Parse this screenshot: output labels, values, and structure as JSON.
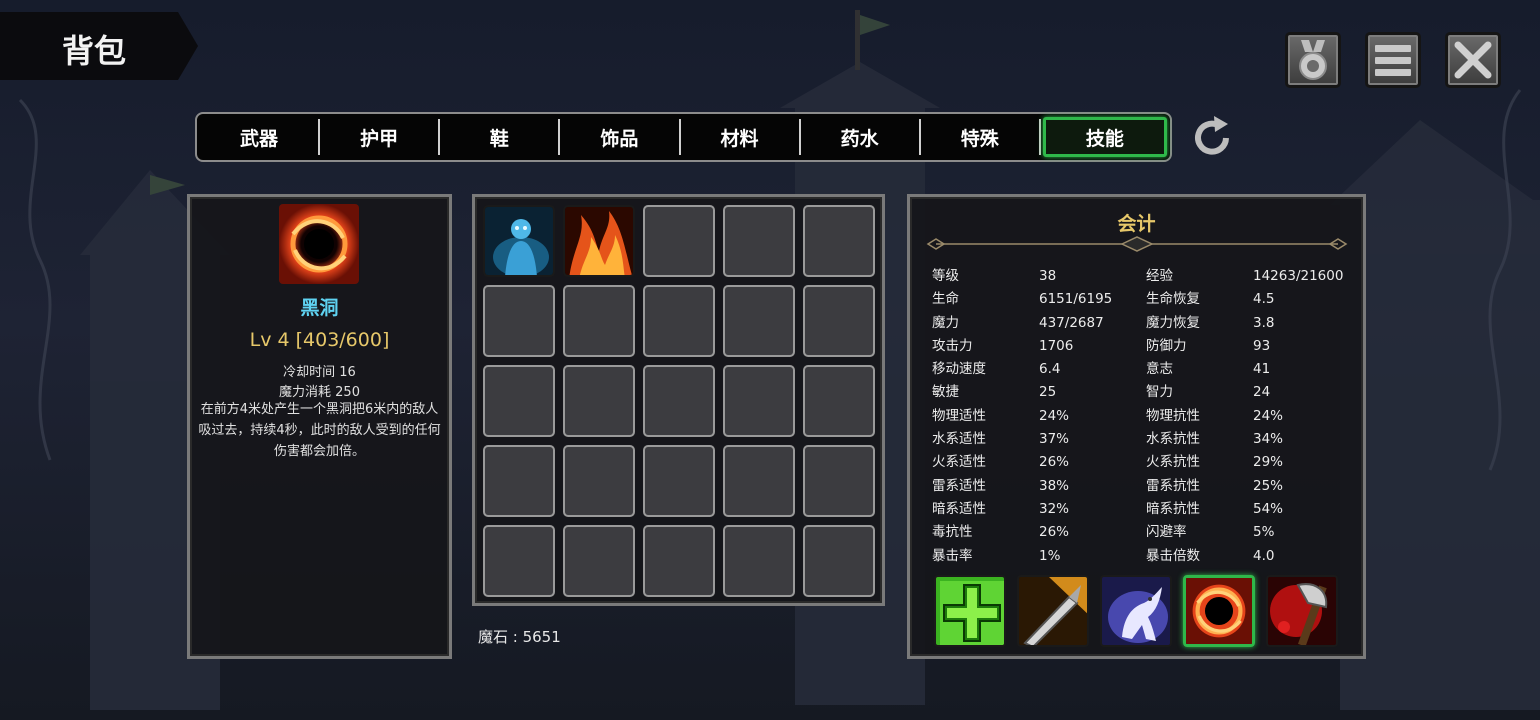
{
  "title": "背包",
  "top_buttons": [
    {
      "name": "medal-button",
      "icon": "medal-icon"
    },
    {
      "name": "menu-button",
      "icon": "hamburger-menu-icon"
    },
    {
      "name": "close-button",
      "icon": "close-icon"
    }
  ],
  "tabs": [
    "武器",
    "护甲",
    "鞋",
    "饰品",
    "材料",
    "药水",
    "特殊",
    "技能"
  ],
  "active_tab": "技能",
  "skill": {
    "name": "黑洞",
    "level": "Lv 4 [403/600]",
    "cooldown": "冷却时间 16",
    "mana_cost": "魔力消耗 250",
    "description": "在前方4米处产生一个黑洞把6米内的敌人吸过去，持续4秒，此时的敌人受到的任何伤害都会加倍。"
  },
  "inventory": {
    "slots_total": 25,
    "filled": [
      "spirit-skill-icon",
      "fire-skill-icon"
    ]
  },
  "magic_stone": "魔石 : 5651",
  "stats_panel": {
    "title": "会计",
    "rows": [
      [
        "等级",
        "38",
        "经验",
        "14263/21600"
      ],
      [
        "生命",
        "6151/6195",
        "生命恢复",
        "4.5"
      ],
      [
        "魔力",
        "437/2687",
        "魔力恢复",
        "3.8"
      ],
      [
        "攻击力",
        "1706",
        "防御力",
        "93"
      ],
      [
        "移动速度",
        "6.4",
        "意志",
        "41"
      ],
      [
        "敏捷",
        "25",
        "智力",
        "24"
      ],
      [
        "物理适性",
        "24%",
        "物理抗性",
        "24%"
      ],
      [
        "水系适性",
        "37%",
        "水系抗性",
        "34%"
      ],
      [
        "火系适性",
        "26%",
        "火系抗性",
        "29%"
      ],
      [
        "雷系适性",
        "38%",
        "雷系抗性",
        "25%"
      ],
      [
        "暗系适性",
        "32%",
        "暗系抗性",
        "54%"
      ],
      [
        "毒抗性",
        "26%",
        "闪避率",
        "5%"
      ],
      [
        "暴击率",
        "1%",
        "暴击倍数",
        "4.0"
      ]
    ]
  },
  "equipped_skills": [
    "heal-cross-icon",
    "sword-slash-icon",
    "ghost-beast-icon",
    "black-hole-icon",
    "bloody-axe-icon"
  ],
  "selected_equipped_skill": 3,
  "colors": {
    "accent_green": "#2fb84a",
    "skill_name": "#5fd3f2",
    "gold": "#e7c86a"
  }
}
